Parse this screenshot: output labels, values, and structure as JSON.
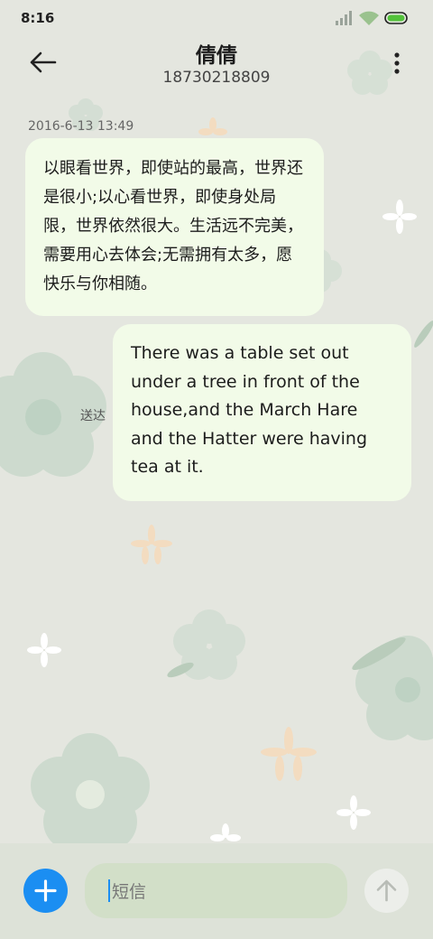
{
  "status_bar": {
    "time": "8:16",
    "icons": [
      "signal-icon",
      "wifi-icon",
      "battery-icon"
    ]
  },
  "header": {
    "contact_name": "倩倩",
    "phone_number": "18730218809",
    "icons": [
      "back-arrow-icon",
      "more-vertical-icon"
    ]
  },
  "conversation": {
    "timestamp": "2016-6-13 13:49",
    "messages": [
      {
        "direction": "incoming",
        "text": "以眼看世界，即使站的最高，世界还是很小;以心看世界，即使身处局限，世界依然很大。生活远不完美，需要用心去体会;无需拥有太多，愿快乐与你相随。"
      },
      {
        "direction": "outgoing",
        "text": "There was a table set out under a tree in front of the house,and the March Hare and the Hatter were having tea at it.",
        "status": "送达"
      }
    ]
  },
  "composer": {
    "placeholder": "短信",
    "add_icon": "plus-icon",
    "send_icon": "arrow-up-icon"
  },
  "colors": {
    "background": "#e4e6df",
    "bubble": "#f2fbe8",
    "accent": "#1b8ef2",
    "composer_bar": "#dde2d8",
    "input_field": "#d2dfc8"
  }
}
